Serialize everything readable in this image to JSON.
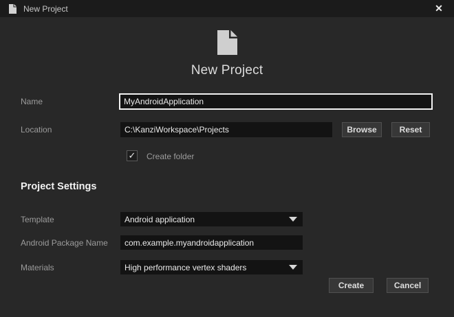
{
  "window": {
    "title": "New Project",
    "close_glyph": "✕"
  },
  "header": {
    "title": "New Project"
  },
  "form": {
    "name": {
      "label": "Name",
      "value": "MyAndroidApplication"
    },
    "location": {
      "label": "Location",
      "value": "C:\\KanziWorkspace\\Projects",
      "browse_label": "Browse",
      "reset_label": "Reset"
    },
    "create_folder": {
      "label": "Create folder",
      "checked": true,
      "check_glyph": "✓"
    },
    "section_title": "Project Settings",
    "template": {
      "label": "Template",
      "value": "Android application"
    },
    "package": {
      "label": "Android Package Name",
      "value": "com.example.myandroidapplication"
    },
    "materials": {
      "label": "Materials",
      "value": "High performance vertex shaders"
    }
  },
  "actions": {
    "create_label": "Create",
    "cancel_label": "Cancel"
  },
  "colors": {
    "titlebar_bg": "#1b1b1b",
    "dialog_bg": "#282828",
    "input_bg": "#131313",
    "focused_border": "#f2f2f2",
    "button_bg": "#373737",
    "label_text": "#9c9c9c",
    "value_text": "#ebebeb"
  }
}
